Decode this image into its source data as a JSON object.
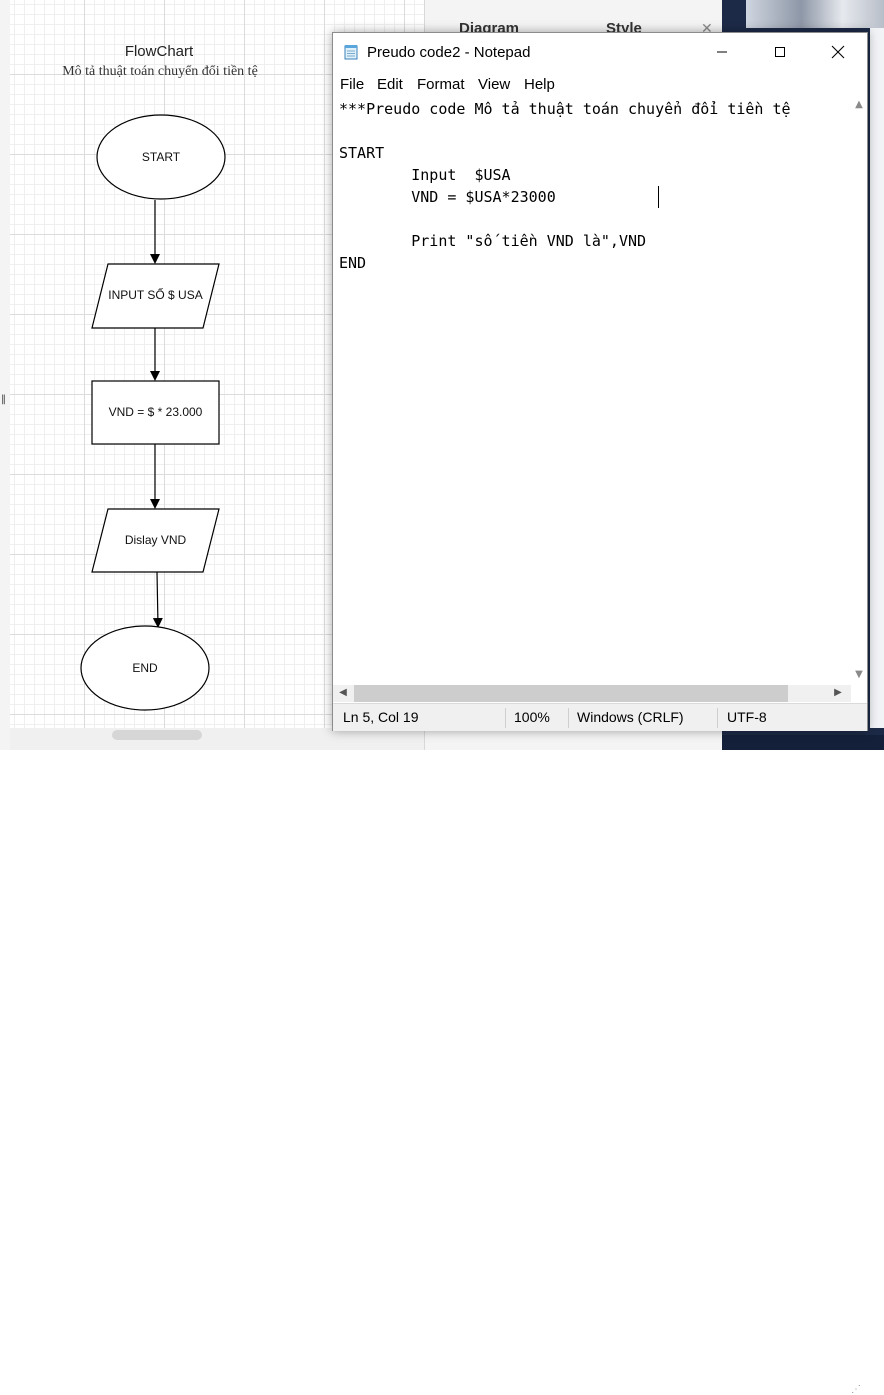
{
  "drawio": {
    "panel_tabs": [
      "Diagram",
      "Style"
    ],
    "close_glyph": "✕",
    "flowchart": {
      "title": "FlowChart",
      "subtitle": "Mô tả thuật toán chuyển đổi tiền tệ",
      "nodes": {
        "start": "START",
        "input": "INPUT SỐ $ USA",
        "process": "VND = $ * 23.000",
        "display": "Dislay VND",
        "end": "END"
      }
    }
  },
  "notepad": {
    "title": "Preudo code2 - Notepad",
    "menu": [
      "File",
      "Edit",
      "Format",
      "View",
      "Help"
    ],
    "lines": [
      "***Preudo code Mô tả thuật toán chuyển đổi tiền tệ",
      "",
      "START",
      "\tInput  $USA",
      "\tVND = $USA*23000",
      "",
      "\tPrint \"số tiền VND là\",VND",
      "END"
    ],
    "status": {
      "position": "Ln 5, Col 19",
      "zoom": "100%",
      "line_ending": "Windows (CRLF)",
      "encoding": "UTF-8"
    }
  },
  "icons": {
    "notepad": "notepad-icon",
    "minimize": "minimize-icon",
    "maximize": "maximize-icon",
    "close": "close-icon"
  }
}
